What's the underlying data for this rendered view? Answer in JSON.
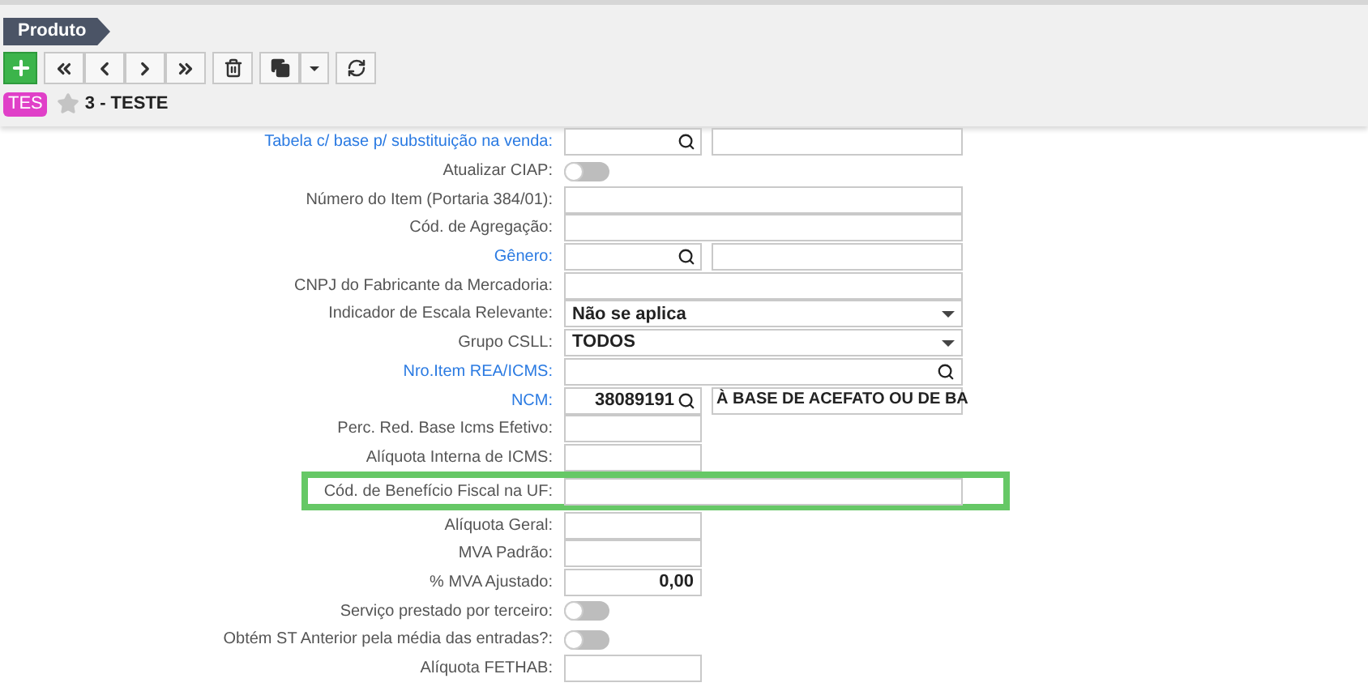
{
  "breadcrumb": "Produto",
  "record": {
    "tag": "TES",
    "favorite": false,
    "title": "3 - TESTE"
  },
  "fields": [
    {
      "label": "Tabela c/ base p/ substituição na venda:",
      "link": true,
      "kind": "lookup"
    },
    {
      "label": "Atualizar CIAP:",
      "link": false,
      "kind": "toggle",
      "on": false
    },
    {
      "label": "Número do Item (Portaria 384/01):",
      "link": false,
      "kind": "text"
    },
    {
      "label": "Cód. de Agregação:",
      "link": false,
      "kind": "text"
    },
    {
      "label": "Gênero:",
      "link": true,
      "kind": "lookup"
    },
    {
      "label": "CNPJ do Fabricante da Mercadoria:",
      "link": false,
      "kind": "text"
    },
    {
      "label": "Indicador de Escala Relevante:",
      "link": false,
      "kind": "select",
      "value": "Não se aplica"
    },
    {
      "label": "Grupo CSLL:",
      "link": false,
      "kind": "select",
      "value": "TODOS"
    },
    {
      "label": "Nro.Item REA/ICMS:",
      "link": true,
      "kind": "search"
    },
    {
      "label": "NCM:",
      "link": true,
      "kind": "lookup",
      "value": "38089191",
      "description": "À BASE DE ACEFATO OU DE BA"
    },
    {
      "label": "Perc. Red. Base Icms Efetivo:",
      "link": false,
      "kind": "short"
    },
    {
      "label": "Alíquota Interna de ICMS:",
      "link": false,
      "kind": "short"
    },
    {
      "label": "Cód. de Benefício Fiscal na UF:",
      "link": false,
      "kind": "text",
      "highlighted": true
    },
    {
      "label": "Alíquota Geral:",
      "link": false,
      "kind": "short"
    },
    {
      "label": "MVA Padrão:",
      "link": false,
      "kind": "short"
    },
    {
      "label": "% MVA Ajustado:",
      "link": false,
      "kind": "short",
      "value": "0,00"
    },
    {
      "label": "Serviço prestado por terceiro:",
      "link": false,
      "kind": "toggle",
      "on": false
    },
    {
      "label": "Obtém ST Anterior pela média das entradas?:",
      "link": false,
      "kind": "toggle",
      "on": false
    },
    {
      "label": "Alíquota FETHAB:",
      "link": false,
      "kind": "short"
    }
  ]
}
